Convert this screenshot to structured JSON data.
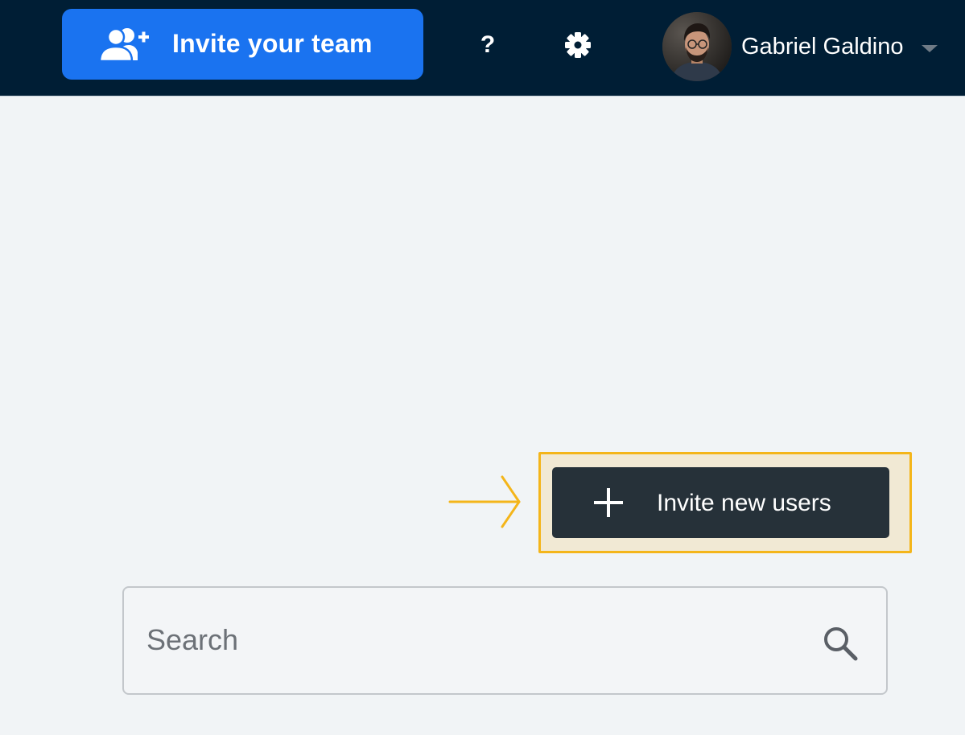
{
  "header": {
    "invite_team_label": "Invite your team",
    "invite_team_icon": "add-users-icon",
    "help_label": "?",
    "settings_icon": "gear-icon",
    "user": {
      "name": "Gabriel Galdino",
      "avatar_icon": "user-avatar",
      "caret_icon": "chevron-down-icon"
    }
  },
  "main": {
    "annotation_icon": "arrow-right-icon",
    "invite_users_button": {
      "label": "Invite new users",
      "icon": "plus-icon"
    },
    "search": {
      "placeholder": "Search",
      "value": "",
      "icon": "search-icon"
    }
  },
  "colors": {
    "topbar": "#001e35",
    "primary_button": "#1a73f0",
    "dark_button": "#263139",
    "highlight_border": "#f4b51a",
    "highlight_fill": "#f1e9d4",
    "background": "#f1f4f6"
  }
}
